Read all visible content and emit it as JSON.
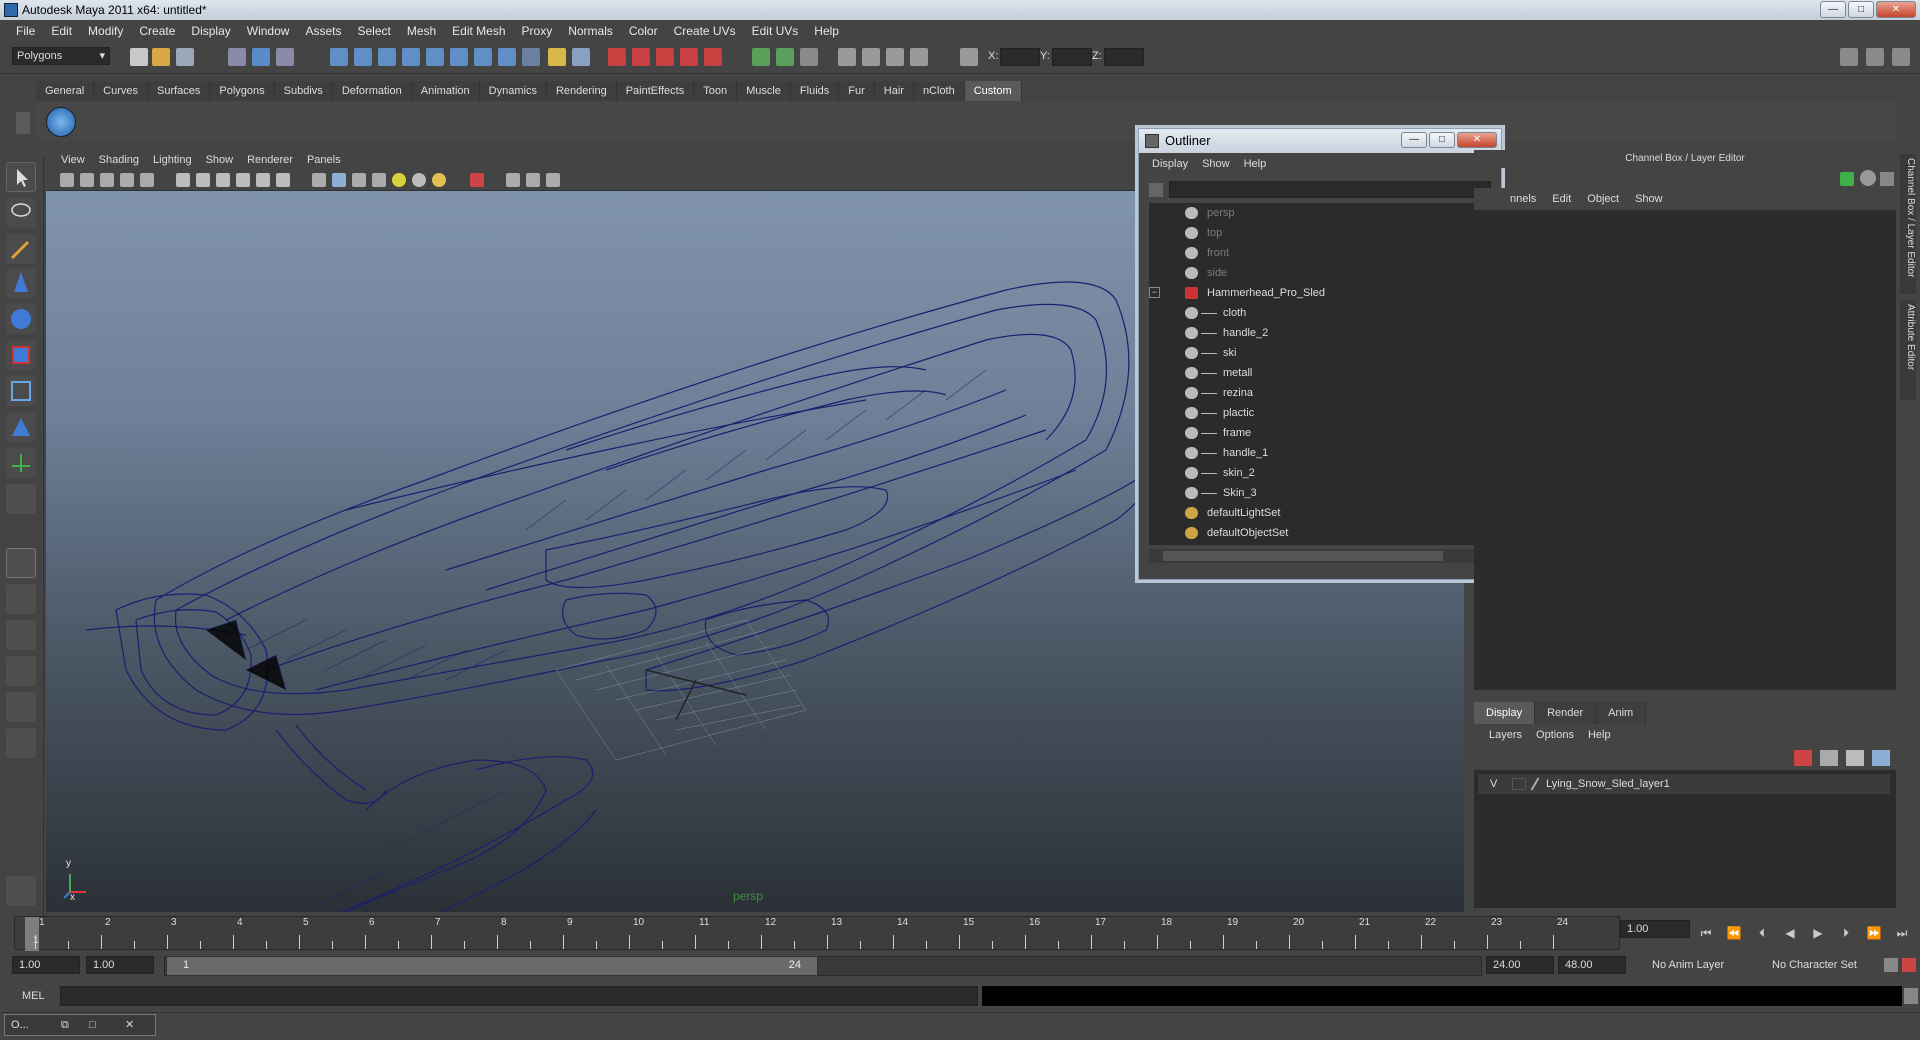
{
  "window": {
    "title": "Autodesk Maya 2011 x64: untitled*",
    "min": "—",
    "max": "□",
    "close": "✕"
  },
  "menubar": [
    "File",
    "Edit",
    "Modify",
    "Create",
    "Display",
    "Window",
    "Assets",
    "Select",
    "Mesh",
    "Edit Mesh",
    "Proxy",
    "Normals",
    "Color",
    "Create UVs",
    "Edit UVs",
    "Help"
  ],
  "status": {
    "menu_set": "Polygons",
    "x_label": "X:",
    "y_label": "Y:",
    "z_label": "Z:"
  },
  "shelf_tabs": [
    {
      "label": "General",
      "active": false
    },
    {
      "label": "Curves",
      "active": false
    },
    {
      "label": "Surfaces",
      "active": false
    },
    {
      "label": "Polygons",
      "active": false
    },
    {
      "label": "Subdivs",
      "active": false
    },
    {
      "label": "Deformation",
      "active": false
    },
    {
      "label": "Animation",
      "active": false
    },
    {
      "label": "Dynamics",
      "active": false
    },
    {
      "label": "Rendering",
      "active": false
    },
    {
      "label": "PaintEffects",
      "active": false
    },
    {
      "label": "Toon",
      "active": false
    },
    {
      "label": "Muscle",
      "active": false
    },
    {
      "label": "Fluids",
      "active": false
    },
    {
      "label": "Fur",
      "active": false
    },
    {
      "label": "Hair",
      "active": false
    },
    {
      "label": "nCloth",
      "active": false
    },
    {
      "label": "Custom",
      "active": true
    }
  ],
  "viewport": {
    "menus": [
      "View",
      "Shading",
      "Lighting",
      "Show",
      "Renderer",
      "Panels"
    ],
    "camera_label": "persp",
    "axis_x": "x",
    "axis_y": "y"
  },
  "outliner": {
    "title": "Outliner",
    "menus": [
      "Display",
      "Show",
      "Help"
    ],
    "items": [
      {
        "label": "persp",
        "indent": 0,
        "dim": true,
        "icon": "camera-icon"
      },
      {
        "label": "top",
        "indent": 0,
        "dim": true,
        "icon": "camera-icon"
      },
      {
        "label": "front",
        "indent": 0,
        "dim": true,
        "icon": "camera-icon"
      },
      {
        "label": "side",
        "indent": 0,
        "dim": true,
        "icon": "camera-icon"
      },
      {
        "label": "Hammerhead_Pro_Sled",
        "indent": 0,
        "dim": false,
        "icon": "group-icon",
        "expanded": true
      },
      {
        "label": "cloth",
        "indent": 1,
        "dim": false,
        "icon": "mesh-icon"
      },
      {
        "label": "handle_2",
        "indent": 1,
        "dim": false,
        "icon": "mesh-icon"
      },
      {
        "label": "ski",
        "indent": 1,
        "dim": false,
        "icon": "mesh-icon"
      },
      {
        "label": "metall",
        "indent": 1,
        "dim": false,
        "icon": "mesh-icon"
      },
      {
        "label": "rezina",
        "indent": 1,
        "dim": false,
        "icon": "mesh-icon"
      },
      {
        "label": "plactic",
        "indent": 1,
        "dim": false,
        "icon": "mesh-icon"
      },
      {
        "label": "frame",
        "indent": 1,
        "dim": false,
        "icon": "mesh-icon"
      },
      {
        "label": "handle_1",
        "indent": 1,
        "dim": false,
        "icon": "mesh-icon"
      },
      {
        "label": "skin_2",
        "indent": 1,
        "dim": false,
        "icon": "mesh-icon"
      },
      {
        "label": "Skin_3",
        "indent": 1,
        "dim": false,
        "icon": "mesh-icon"
      },
      {
        "label": "defaultLightSet",
        "indent": 0,
        "dim": false,
        "icon": "set-icon"
      },
      {
        "label": "defaultObjectSet",
        "indent": 0,
        "dim": false,
        "icon": "set-icon"
      }
    ]
  },
  "channel_box": {
    "header": "Channel Box / Layer Editor",
    "menus": [
      "nnels",
      "Edit",
      "Object",
      "Show"
    ]
  },
  "side_tabs": [
    "Channel Box / Layer Editor",
    "Attribute Editor"
  ],
  "layer_editor": {
    "tabs": [
      {
        "label": "Display",
        "active": true
      },
      {
        "label": "Render",
        "active": false
      },
      {
        "label": "Anim",
        "active": false
      }
    ],
    "menus": [
      "Layers",
      "Options",
      "Help"
    ],
    "layers": [
      {
        "visible": "V",
        "name": "Lying_Snow_Sled_layer1"
      }
    ]
  },
  "time": {
    "ticks": [
      "1",
      "2",
      "3",
      "4",
      "5",
      "6",
      "7",
      "8",
      "9",
      "10",
      "11",
      "12",
      "13",
      "14",
      "15",
      "16",
      "17",
      "18",
      "19",
      "20",
      "21",
      "22",
      "23",
      "24"
    ],
    "current_frame": "1",
    "current_time_field": "1.00",
    "start": "1.00",
    "playback_start": "1.00",
    "range_left": "1",
    "range_right": "24",
    "playback_end": "24.00",
    "end": "48.00",
    "anim_layer": "No Anim Layer",
    "character_set": "No Character Set"
  },
  "command": {
    "mel_label": "MEL"
  },
  "taskbar": {
    "label": "O..."
  },
  "colors": {
    "wireframe": "#1c1e6e",
    "accent": "#5a5a5a"
  }
}
